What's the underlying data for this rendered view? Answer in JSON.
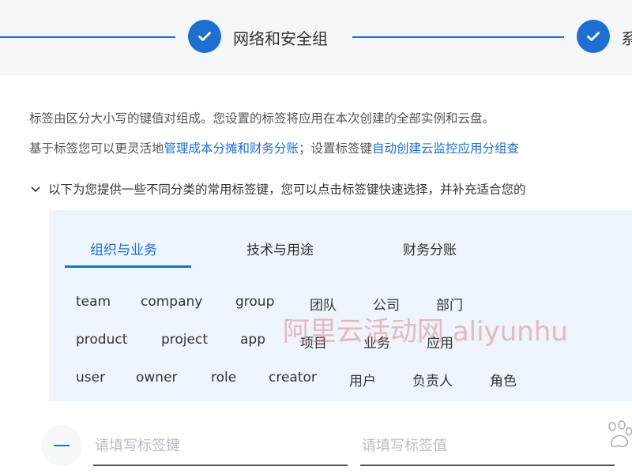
{
  "stepper": {
    "steps": [
      {
        "label": "网络和安全组",
        "completed": true
      },
      {
        "label": "系",
        "completed": true
      }
    ],
    "accent": "#1f6fd1"
  },
  "description": {
    "line1": "标签由区分大小写的键值对组成。您设置的标签将应用在本次创建的全部实例和云盘。",
    "line2_prefix": "基于标签您可以更灵活地",
    "line2_link1": "管理成本分摊和财务分账",
    "line2_mid": "；设置标签键",
    "line2_link2": "自动创建云监控应用分组查"
  },
  "suggest": {
    "toggle_text": "以下为您提供一些不同分类的常用标签键，您可以点击标签键快速选择，并补充适合您的"
  },
  "tabs": [
    {
      "label": "组织与业务",
      "active": true
    },
    {
      "label": "技术与用途",
      "active": false
    },
    {
      "label": "财务分账",
      "active": false
    }
  ],
  "tags": {
    "row1": [
      "team",
      "company",
      "group",
      "团队",
      "公司",
      "部门"
    ],
    "row2": [
      "product",
      "project",
      "app",
      "项目",
      "业务",
      "应用"
    ],
    "row3": [
      "user",
      "owner",
      "role",
      "creator",
      "用户",
      "负责人",
      "角色"
    ]
  },
  "watermark": "阿里云活动网 aliyunhu",
  "inputs": {
    "key_placeholder": "请填写标签键",
    "value_placeholder": "请填写标签值"
  }
}
